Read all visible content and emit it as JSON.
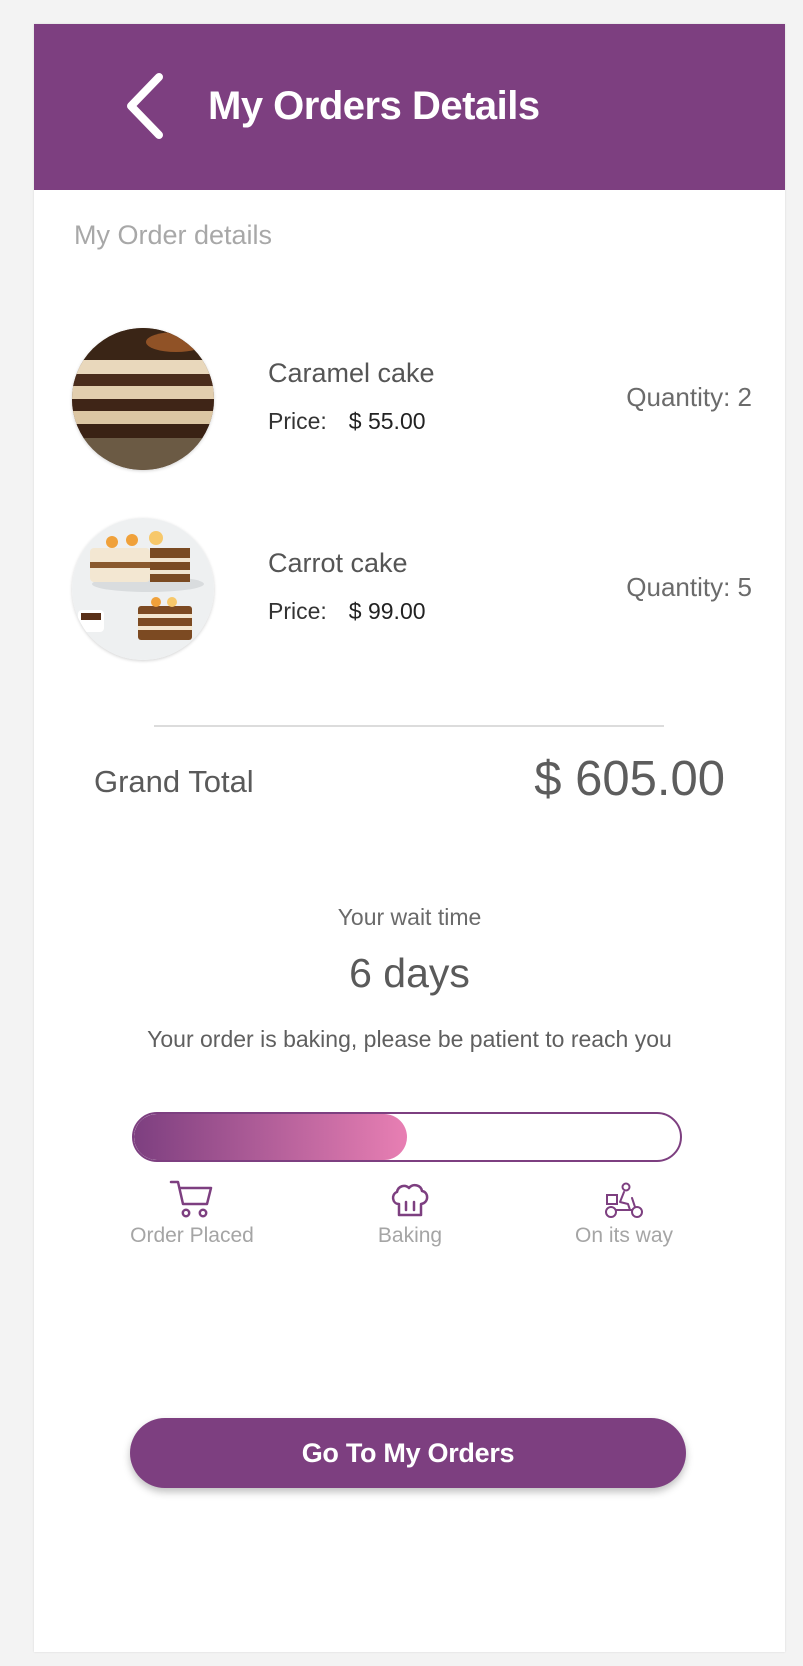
{
  "header": {
    "title": "My Orders Details",
    "back_icon": "chevron-left-icon"
  },
  "section": {
    "label": "My Order details"
  },
  "items": [
    {
      "name": "Caramel cake",
      "price_label": "Price:",
      "price": "$ 55.00",
      "quantity": "Quantity: 2",
      "image": "caramel-cake-photo"
    },
    {
      "name": "Carrot cake",
      "price_label": "Price:",
      "price": "$ 99.00",
      "quantity": "Quantity: 5",
      "image": "carrot-cake-photo"
    }
  ],
  "total": {
    "label": "Grand Total",
    "value": "$ 605.00"
  },
  "wait": {
    "label": "Your wait time",
    "value": "6 days",
    "message": "Your order is baking, please be patient to reach you"
  },
  "progress": {
    "fraction": 0.5,
    "steps": [
      {
        "label": "Order Placed",
        "icon": "cart-icon"
      },
      {
        "label": "Baking",
        "icon": "chef-hat-icon"
      },
      {
        "label": "On its way",
        "icon": "delivery-rider-icon"
      }
    ]
  },
  "cta": {
    "label": "Go To My Orders"
  },
  "colors": {
    "primary": "#7d3f80",
    "accent_gradient_end": "#e87fb3",
    "background": "#ffffff"
  }
}
